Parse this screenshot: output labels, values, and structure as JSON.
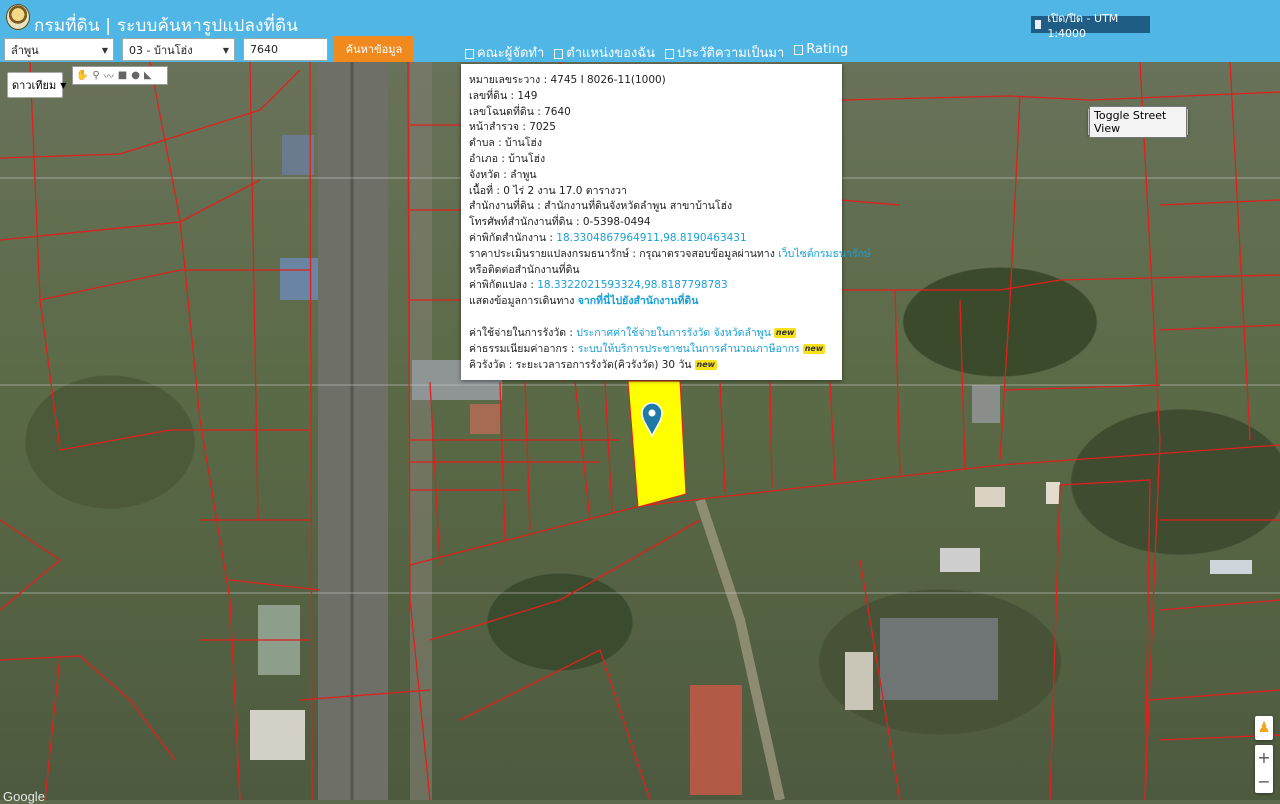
{
  "header": {
    "title": "กรมที่ดิน | ระบบค้นหารูปแปลงที่ดิน",
    "utm_toggle_label": "เปิด/ปิด - UTM 1:4000"
  },
  "search": {
    "province": "ลำพูน",
    "district": "03 - บ้านโฮ่ง",
    "deed_number": "7640",
    "submit_label": "ค้นหาข้อมูล"
  },
  "nav": {
    "items": [
      "คณะผู้จัดทำ",
      "ตำแหน่งของฉัน",
      "ประวัติความเป็นมา",
      "Rating"
    ]
  },
  "map": {
    "type_label": "ดาวเทียม",
    "street_view_label": "Toggle Street View",
    "parcel_color": "#ffff00",
    "boundary_color": "#e0201e",
    "attribution": "Google",
    "zoom_in": "+",
    "zoom_out": "−"
  },
  "popup": {
    "sheet": "หมายเลขระวาง : 4745 I 8026-11(1000)",
    "land_no": "เลขที่ดิน : 149",
    "deed_no": "เลขโฉนดที่ดิน : 7640",
    "survey_page": "หน้าสำรวจ : 7025",
    "subdistrict": "ตำบล : บ้านโฮ่ง",
    "district": "อำเภอ : บ้านโฮ่ง",
    "province": "จังหวัด : ลำพูน",
    "area": "เนื้อที่ : 0 ไร่ 2 งาน 17.0 ตารางวา",
    "office": "สำนักงานที่ดิน : สำนักงานที่ดินจังหวัดลำพูน สาขาบ้านโฮ่ง",
    "phone": "โทรศัพท์สำนักงานที่ดิน : 0-5398-0494",
    "office_coord_label": "ค่าพิกัดสำนักงาน : ",
    "office_coord": "18.3304867964911,98.8190463431",
    "price_label": "ราคาประเมินรายแปลงกรมธนารักษ์ : กรุณาตรวจสอบข้อมูลผ่านทาง ",
    "price_link": "เว็บไซต์กรมธนารักษ์",
    "contact_office": "หรือติดต่อสำนักงานที่ดิน",
    "parcel_coord_label": "ค่าพิกัดแปลง : ",
    "parcel_coord": "18.3322021593324,98.8187798783",
    "route_label": "แสดงข้อมูลการเดินทาง ",
    "route_link": "จากที่นี่ไปยังสำนักงานที่ดิน",
    "fee_label": "ค่าใช้จ่ายในการรังวัด : ",
    "fee_link": "ประกาศค่าใช้จ่ายในการรังวัด จังหวัดลำพูน",
    "tax_label": "ค่าธรรมเนียมค่าอากร : ",
    "tax_link": "ระบบให้บริการประชาชนในการคำนวณภาษีอากร",
    "queue": "คิวรังวัด : ระยะเวลารอการรังวัด(คิวรังวัด) 30 วัน",
    "new_badge": "new"
  }
}
